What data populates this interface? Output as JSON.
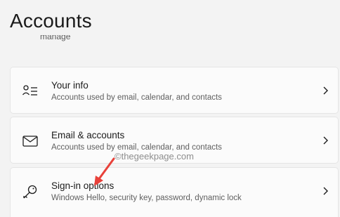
{
  "page": {
    "title": "Accounts",
    "cut_text": "manage"
  },
  "items": [
    {
      "title": "Your info",
      "description": "Accounts used by email, calendar, and contacts",
      "icon": "person-info-icon"
    },
    {
      "title": "Email & accounts",
      "description": "Accounts used by email, calendar, and contacts",
      "icon": "envelope-icon"
    },
    {
      "title": "Sign-in options",
      "description": "Windows Hello, security key, password, dynamic lock",
      "icon": "key-icon"
    }
  ],
  "watermark": "©thegeekpage.com",
  "colors": {
    "background": "#f3f3f3",
    "card": "#fbfbfb",
    "annotation_arrow": "#e8413a"
  }
}
